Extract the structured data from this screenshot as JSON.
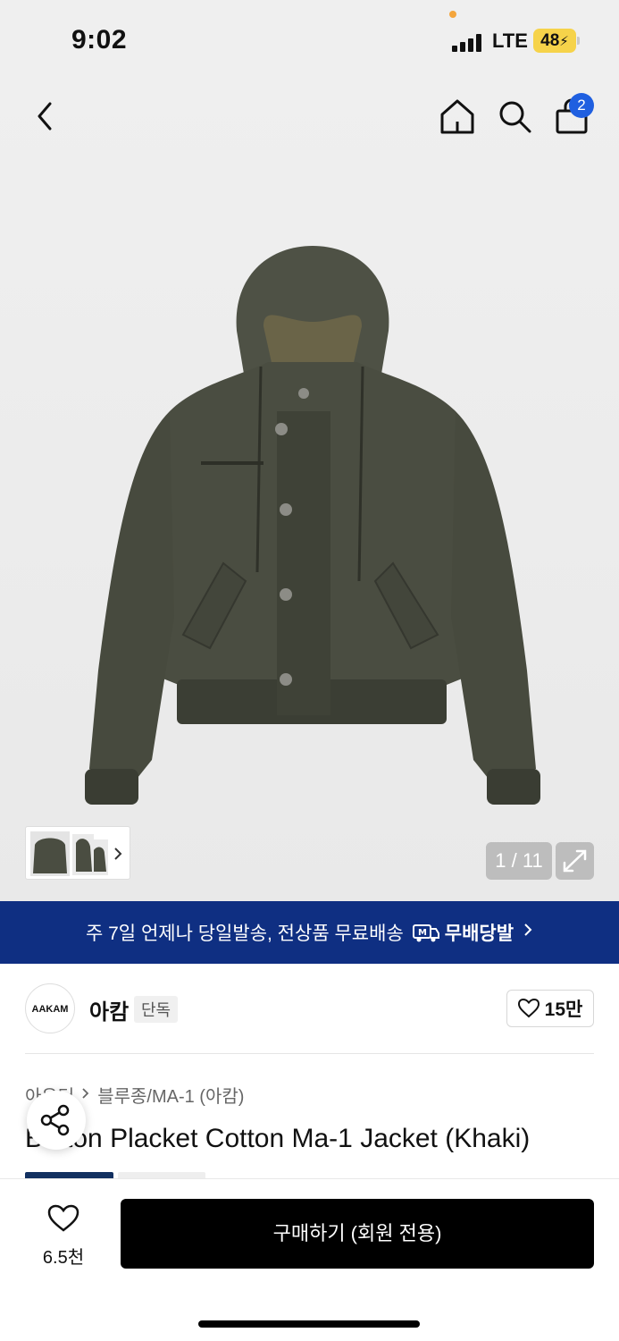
{
  "status": {
    "time": "9:02",
    "network": "LTE",
    "battery": "48"
  },
  "nav": {
    "back_icon": "chevron-left-icon",
    "home_icon": "home-icon",
    "search_icon": "search-icon",
    "cart_icon": "shopping-bag-icon",
    "cart_count": "2"
  },
  "gallery": {
    "counter": "1 / 11",
    "current_index": 1,
    "total": 11
  },
  "promo": {
    "text": "주 7일 언제나 당일발송, 전상품 무료배송",
    "brand": "무배당발"
  },
  "brand": {
    "logo_text": "AAKAM",
    "name": "아캄",
    "tag": "단독",
    "likes": "15만"
  },
  "breadcrumb": {
    "category": "아우터",
    "subcategory": "블루종/MA-1 (아캄)"
  },
  "product": {
    "title": "Button Placket Cotton Ma-1 Jacket (Khaki)"
  },
  "bottom": {
    "wish_count": "6.5천",
    "buy_label": "구매하기 (회원 전용)"
  },
  "colors": {
    "promo_bg": "#0f2f82",
    "badge": "#1f5fe0",
    "jacket": "#4a4d41",
    "buy_bg": "#000000"
  }
}
